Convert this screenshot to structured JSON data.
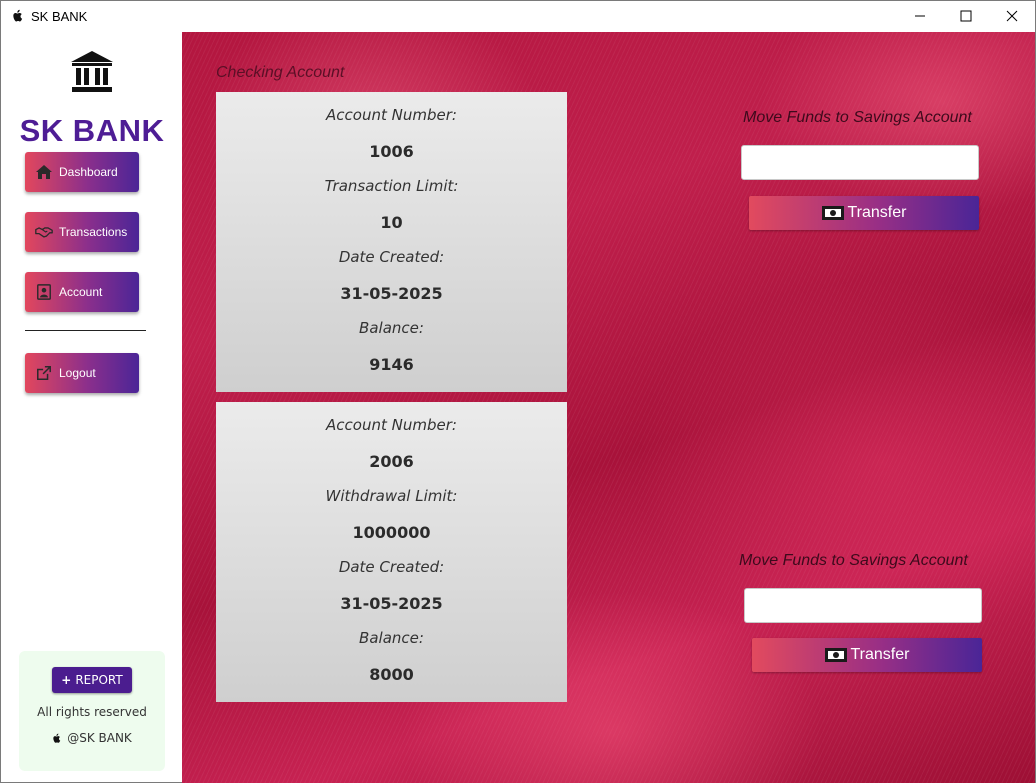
{
  "window": {
    "title": "SK BANK"
  },
  "sidebar": {
    "brand": "SK BANK",
    "items": [
      {
        "label": "Dashboard",
        "icon": "home-icon"
      },
      {
        "label": "Transactions",
        "icon": "handshake-icon"
      },
      {
        "label": "Account",
        "icon": "account-icon"
      },
      {
        "label": "Logout",
        "icon": "external-link-icon"
      }
    ],
    "footer": {
      "report_label": "REPORT",
      "rights": "All rights reserved",
      "handle": "@SK BANK"
    }
  },
  "main": {
    "section_label": "Checking Account",
    "checking": {
      "account_number_label": "Account Number:",
      "account_number": "1006",
      "limit_label": "Transaction Limit:",
      "limit": "10",
      "date_label": "Date Created:",
      "date": "31-05-2025",
      "balance_label": "Balance:",
      "balance": "9146"
    },
    "savings": {
      "account_number_label": "Account Number:",
      "account_number": "2006",
      "limit_label": "Withdrawal Limit:",
      "limit": "1000000",
      "date_label": "Date Created:",
      "date": "31-05-2025",
      "balance_label": "Balance:",
      "balance": "8000"
    },
    "transfer_top": {
      "title": "Move Funds to Savings Account",
      "input_value": "",
      "button_label": "Transfer"
    },
    "transfer_bottom": {
      "title": "Move Funds to Savings Account",
      "input_value": "",
      "button_label": "Transfer"
    }
  },
  "colors": {
    "brand": "#4e1d95",
    "button_gradient_start": "#e2475d",
    "button_gradient_end": "#4b2597",
    "background": "#b3163f"
  }
}
